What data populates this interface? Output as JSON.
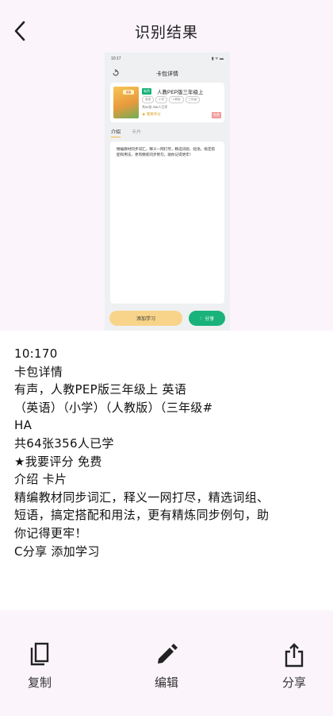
{
  "header": {
    "title": "识别结果"
  },
  "preview": {
    "status_time": "10:17",
    "page_title": "卡包详情",
    "book_badge": "有声",
    "book_title": "人教PEP版三年级上",
    "cover_label": "英语",
    "tags": [
      "英语",
      "小学",
      "人教版",
      "三年级"
    ],
    "meta": "共64张   356人已学",
    "rating": "★ 我要评分",
    "price": "免费",
    "tab_intro": "介绍",
    "tab_cards": "卡片",
    "intro_text": "精编教材同步词汇，释义一网打尽，精选词组、短语，搞定搭配和用法，更有精炼同步例句，助你记得更牢！",
    "add_button": "添加学习",
    "share_button": "分享"
  },
  "result": {
    "lines": [
      "10:170",
      "卡包详情",
      "有声，人教PEP版三年级上 英语",
      "（英语）（小学）（人教版）（三年级#",
      "HA",
      "共64张356人已学",
      "★我要评分 免费",
      "介绍 卡片",
      "精编教材同步词汇，释义一网打尽，精选词组、",
      "短语，搞定搭配和用法，更有精炼同步例句，助",
      "你记得更牢！",
      "C分享 添加学习"
    ]
  },
  "actions": {
    "copy_label": "复制",
    "edit_label": "编辑",
    "share_label": "分享"
  },
  "colors": {
    "background": "#fbf4fb",
    "accent_green": "#18b27a",
    "accent_yellow": "#f8d48a"
  }
}
